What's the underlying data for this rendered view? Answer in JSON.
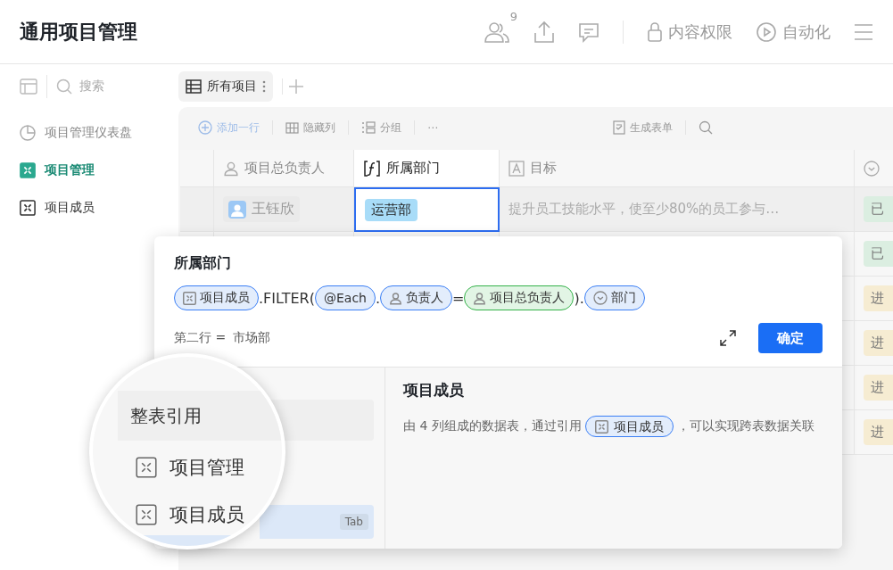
{
  "header": {
    "title": "通用项目管理",
    "collaborator_count": "9",
    "permission_label": "内容权限",
    "automation_label": "自动化"
  },
  "sidebar": {
    "search_placeholder": "搜索",
    "items": [
      {
        "label": "项目管理仪表盘",
        "kind": "dashboard",
        "selected": false
      },
      {
        "label": "项目管理",
        "kind": "table",
        "selected": true
      },
      {
        "label": "项目成员",
        "kind": "table",
        "selected": false
      }
    ]
  },
  "view_tabs": [
    {
      "label": "所有项目",
      "selected": true
    }
  ],
  "toolbar": {
    "left": [
      {
        "label": "添加一行",
        "kind": "add"
      },
      {
        "label": "隐藏列",
        "kind": "hide"
      },
      {
        "label": "分组",
        "kind": "group"
      },
      {
        "label": "⋯",
        "kind": "more"
      }
    ],
    "right": [
      {
        "label": "生成表单",
        "kind": "form"
      }
    ]
  },
  "table": {
    "columns": [
      {
        "label": "项目总负责人",
        "kind": "person"
      },
      {
        "label": "所属部门",
        "kind": "formula"
      },
      {
        "label": "目标",
        "kind": "text"
      },
      {
        "kind": "select"
      }
    ],
    "rows": [
      {
        "owner": "王钰欣",
        "department": "运营部",
        "goal": "提升员工技能水平，使至少80%的员工参与…",
        "status": "已",
        "color": "#dbeee1",
        "selected": true
      },
      {
        "status": "已",
        "color": "#dbeee1",
        "selected": false
      },
      {
        "status": "进",
        "color": "#f6ecd2",
        "selected": false
      },
      {
        "status": "进",
        "color": "#f6ecd2",
        "selected": false
      },
      {
        "status": "进",
        "color": "#f6ecd2",
        "selected": false
      },
      {
        "status": "进",
        "color": "#f6ecd2",
        "selected": false
      }
    ]
  },
  "formula_editor": {
    "title": "所属部门",
    "tokens": [
      {
        "kind": "table",
        "label": "项目成员",
        "color": "#3b7ff5"
      },
      {
        "kind": "text",
        "label": ".FILTER("
      },
      {
        "kind": "each",
        "label": "@Each",
        "color": "#3b7ff5"
      },
      {
        "kind": "text",
        "label": "."
      },
      {
        "kind": "person",
        "label": "负责人",
        "color": "#3b7ff5"
      },
      {
        "kind": "text",
        "label": "="
      },
      {
        "kind": "person",
        "label": "项目总负责人",
        "color": "#35b24a"
      },
      {
        "kind": "text",
        "label": ")."
      },
      {
        "kind": "select",
        "label": "部门",
        "color": "#3b7ff5"
      }
    ],
    "result_label": "第二行 =",
    "result_value": "市场部",
    "confirm_button": "确定",
    "reference_list": [
      {
        "kind": "header",
        "label": "整表引用"
      },
      {
        "kind": "table",
        "label": "项目管理",
        "selected": false
      },
      {
        "kind": "table",
        "label": "项目成员",
        "selected": true,
        "hint": "Tab"
      }
    ],
    "detail": {
      "title": "项目成员",
      "description_before": "由 4 列组成的数据表，通过引用",
      "reference": "项目成员",
      "description_after": "，可以实现跨表数据关联"
    }
  }
}
